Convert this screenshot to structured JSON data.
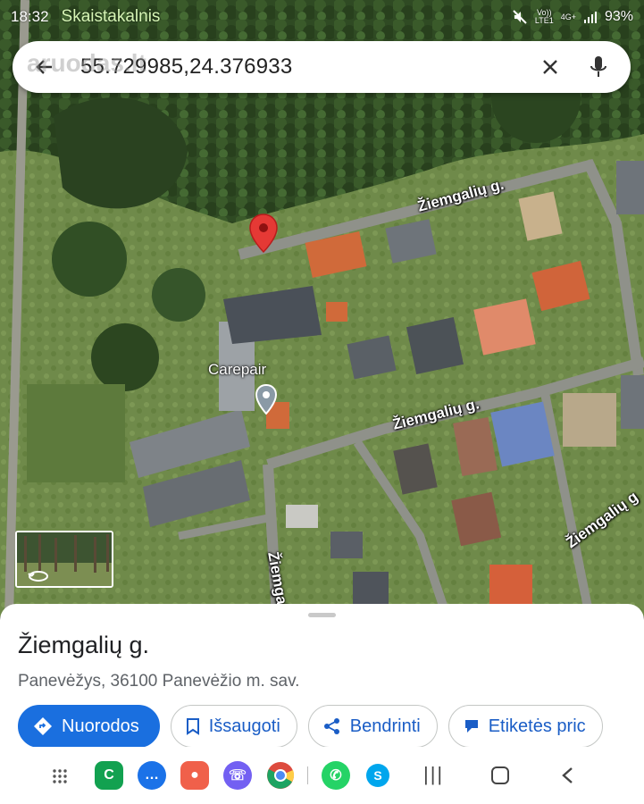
{
  "status_bar": {
    "time": "18:32",
    "place": "Skaistakalnis",
    "signal_top": "Vo))",
    "signal_bottom": "LTE1",
    "network": "4G+",
    "battery": "93%"
  },
  "search": {
    "query": "55.729985,24.376933",
    "watermark": "aruodas.lt"
  },
  "map": {
    "road_labels": [
      "Žiemgalių g.",
      "Žiemgalių g.",
      "Žiemgalių g",
      "Žiemgal"
    ],
    "poi_label": "Carepair"
  },
  "place": {
    "title": "Žiemgalių g.",
    "address": "Panevėžys, 36100 Panevėžio m. sav."
  },
  "actions": [
    {
      "label": "Nuorodos",
      "icon": "directions-icon"
    },
    {
      "label": "Išsaugoti",
      "icon": "bookmark-icon"
    },
    {
      "label": "Bendrinti",
      "icon": "share-icon"
    },
    {
      "label": "Etiketės pric",
      "icon": "label-icon"
    }
  ],
  "nav_apps": [
    {
      "name": "app-drawer-icon"
    },
    {
      "name": "phone-icon",
      "glyph": "C",
      "color": "#12a150"
    },
    {
      "name": "messages-icon",
      "glyph": "…",
      "color": "#1b72e8"
    },
    {
      "name": "contacts-icon",
      "glyph": "●",
      "color": "#f0604a"
    },
    {
      "name": "viber-icon",
      "glyph": "☏",
      "color": "#7360f2"
    },
    {
      "name": "chrome-icon",
      "glyph": "",
      "color": "#dd4b3e"
    },
    {
      "name": "whatsapp-icon",
      "glyph": "✆",
      "color": "#25d366"
    },
    {
      "name": "skype-icon",
      "glyph": "S",
      "color": "#00a6ed"
    }
  ],
  "colors": {
    "accent": "#1a6fdf",
    "pin": "#e53935",
    "place_text": "#202124"
  }
}
